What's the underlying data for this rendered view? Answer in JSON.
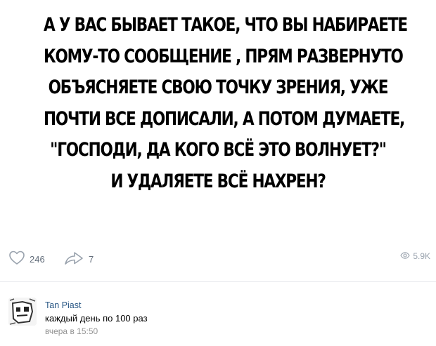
{
  "post": {
    "lines": [
      "А У ВАС БЫВАЕТ ТАКОЕ, ЧТО ВЫ НАБИРАЕТЕ",
      "КОМУ-ТО СООБЩЕНИЕ , ПРЯМ РАЗВЕРНУТО",
      "ОБЪЯСНЯЕТЕ СВОЮ ТОЧКУ ЗРЕНИЯ, УЖЕ",
      "ПОЧТИ ВСЕ ДОПИСАЛИ, А ПОТОМ ДУМАЕТЕ,",
      "\"ГОСПОДИ, ДА КОГО ВСЁ ЭТО ВОЛНУЕТ?\"",
      "И УДАЛЯЕТЕ ВСЁ НАХРЕН?"
    ]
  },
  "actions": {
    "likes": "246",
    "shares": "7",
    "views": "5.9K"
  },
  "comment": {
    "author": "Tan Piast",
    "text": "каждый день по 100 раз",
    "time": "вчера в 15:50"
  },
  "icons": {
    "like": "heart-icon",
    "share": "share-arrow-icon",
    "views": "eye-icon"
  },
  "colors": {
    "link": "#2a5885",
    "muted": "#939393",
    "icon": "#99a2ad"
  }
}
